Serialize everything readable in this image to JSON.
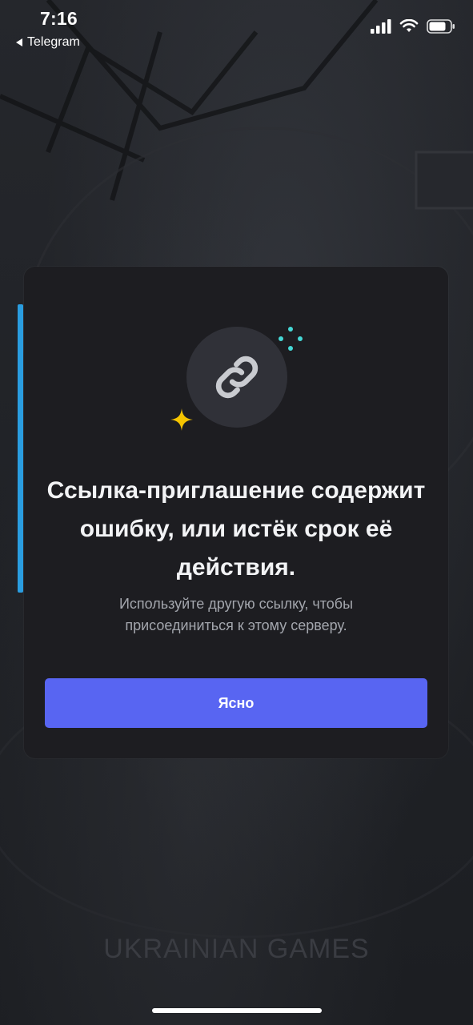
{
  "status_bar": {
    "time": "7:16",
    "back_app": "Telegram"
  },
  "dialog": {
    "title": "Ссылка-приглашение содержит ошибку, или истёк срок её действия.",
    "description": "Используйте другую ссылку, чтобы присоединиться к этому серверу.",
    "button_label": "Ясно",
    "icon": "link-icon"
  },
  "background": {
    "watermark": "UKRAINIAN GAMES"
  },
  "colors": {
    "accent": "#5865f2",
    "modal_bg": "#1d1d21",
    "sparkle_yellow": "#f5c400",
    "sparkle_teal": "#45d8d6"
  }
}
